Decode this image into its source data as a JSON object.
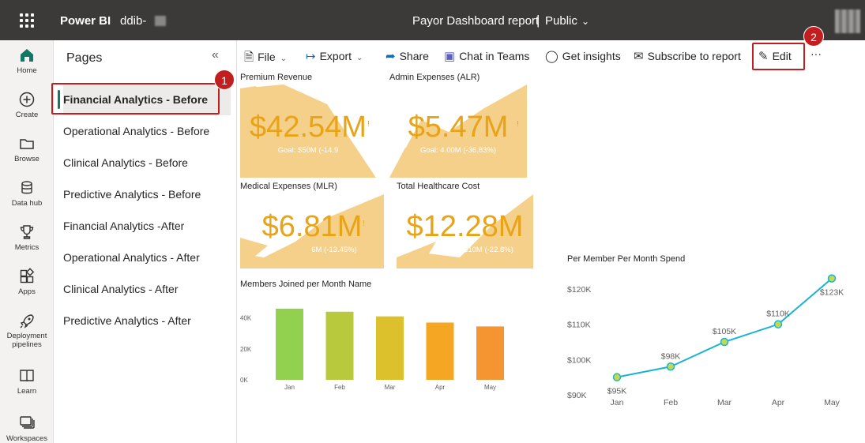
{
  "app": {
    "name": "Power BI",
    "workspace": "ddib-",
    "report_title": "Payor Dashboard report",
    "separator": "|",
    "visibility": "Public"
  },
  "rail": [
    {
      "label": "Home",
      "icon": "home-icon"
    },
    {
      "label": "Create",
      "icon": "plus-circle-icon"
    },
    {
      "label": "Browse",
      "icon": "folder-icon"
    },
    {
      "label": "Data hub",
      "icon": "database-icon"
    },
    {
      "label": "Metrics",
      "icon": "trophy-icon"
    },
    {
      "label": "Apps",
      "icon": "apps-icon"
    },
    {
      "label": "Deployment pipelines",
      "icon": "rocket-icon"
    },
    {
      "label": "Learn",
      "icon": "book-icon"
    },
    {
      "label": "Workspaces",
      "icon": "workspaces-icon"
    }
  ],
  "pages": {
    "title": "Pages",
    "items": [
      "Financial Analytics - Before",
      "Operational Analytics - Before",
      "Clinical Analytics - Before",
      "Predictive Analytics - Before",
      "Financial Analytics -After",
      "Operational Analytics - After",
      "Clinical Analytics - After",
      "Predictive Analytics - After"
    ]
  },
  "toolbar": {
    "file": "File",
    "export": "Export",
    "share": "Share",
    "chat": "Chat in Teams",
    "insights": "Get insights",
    "subscribe": "Subscribe to report",
    "edit": "Edit",
    "more": "···"
  },
  "badges": {
    "one": "1",
    "two": "2"
  },
  "cards": {
    "premium": {
      "title": "Premium Revenue",
      "value": "$42.54M",
      "goal": "Goal: $50M (-14.9",
      "progress": 0.851
    },
    "admin": {
      "title": "Admin Expenses (ALR)",
      "value": "$5.47M",
      "goal": "Goal: 4.00M (-36.83%)",
      "progress": 1.0
    },
    "medical": {
      "title": "Medical Expenses (MLR)",
      "value": "$6.81M",
      "goal": "6M (-13.45%)",
      "progress": 1.0
    },
    "total": {
      "title": "Total Healthcare Cost",
      "value": "$12.28M",
      "goal": "$10M (-22.8%)",
      "progress": 1.0
    },
    "bang": "!"
  },
  "chart_data": [
    {
      "type": "bar",
      "title": "Members Joined per Month Name",
      "categories": [
        "Jan",
        "Feb",
        "Mar",
        "Apr",
        "May"
      ],
      "values": [
        46000,
        44000,
        41000,
        37000,
        34500
      ],
      "colors": [
        "#92d050",
        "#b8c93e",
        "#dcc12c",
        "#f5a623",
        "#f59532"
      ],
      "yticks": [
        "0K",
        "20K",
        "40K"
      ],
      "ylim": [
        0,
        50000
      ]
    },
    {
      "type": "line",
      "title": "Per Member Per Month Spend",
      "categories": [
        "Jan",
        "Feb",
        "Mar",
        "Apr",
        "May"
      ],
      "values": [
        95000,
        98000,
        105000,
        110000,
        123000
      ],
      "labels": [
        "$95K",
        "$98K",
        "$105K",
        "$110K",
        "$123K"
      ],
      "yticks": [
        "$90K",
        "$100K",
        "$110K",
        "$120K"
      ],
      "ylim": [
        90000,
        125000
      ],
      "line_color": "#1ab3d8",
      "marker_color": "#c6d94a"
    }
  ],
  "colors": {
    "kpi_fill": "#f5d08a",
    "kpi_text": "#e8a316",
    "accent": "#117865",
    "callout": "#c11f1f"
  }
}
